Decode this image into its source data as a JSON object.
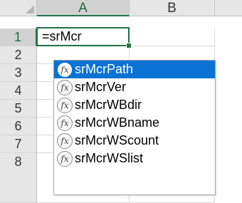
{
  "spreadsheet": {
    "columns": [
      "A",
      "B"
    ],
    "rows": [
      "1",
      "2",
      "3",
      "4",
      "5",
      "6",
      "7",
      "8"
    ],
    "active_cell_value": "=srMcr"
  },
  "autocomplete": {
    "icon_label": "fx",
    "items": [
      {
        "label": "srMcrPath",
        "highlighted": true
      },
      {
        "label": "srMcrVer"
      },
      {
        "label": "srMcrWBdir"
      },
      {
        "label": "srMcrWBname"
      },
      {
        "label": "srMcrWScount"
      },
      {
        "label": "srMcrWSlist"
      }
    ]
  },
  "colors": {
    "selection_green": "#217346",
    "highlight_blue": "#0a72d2"
  }
}
